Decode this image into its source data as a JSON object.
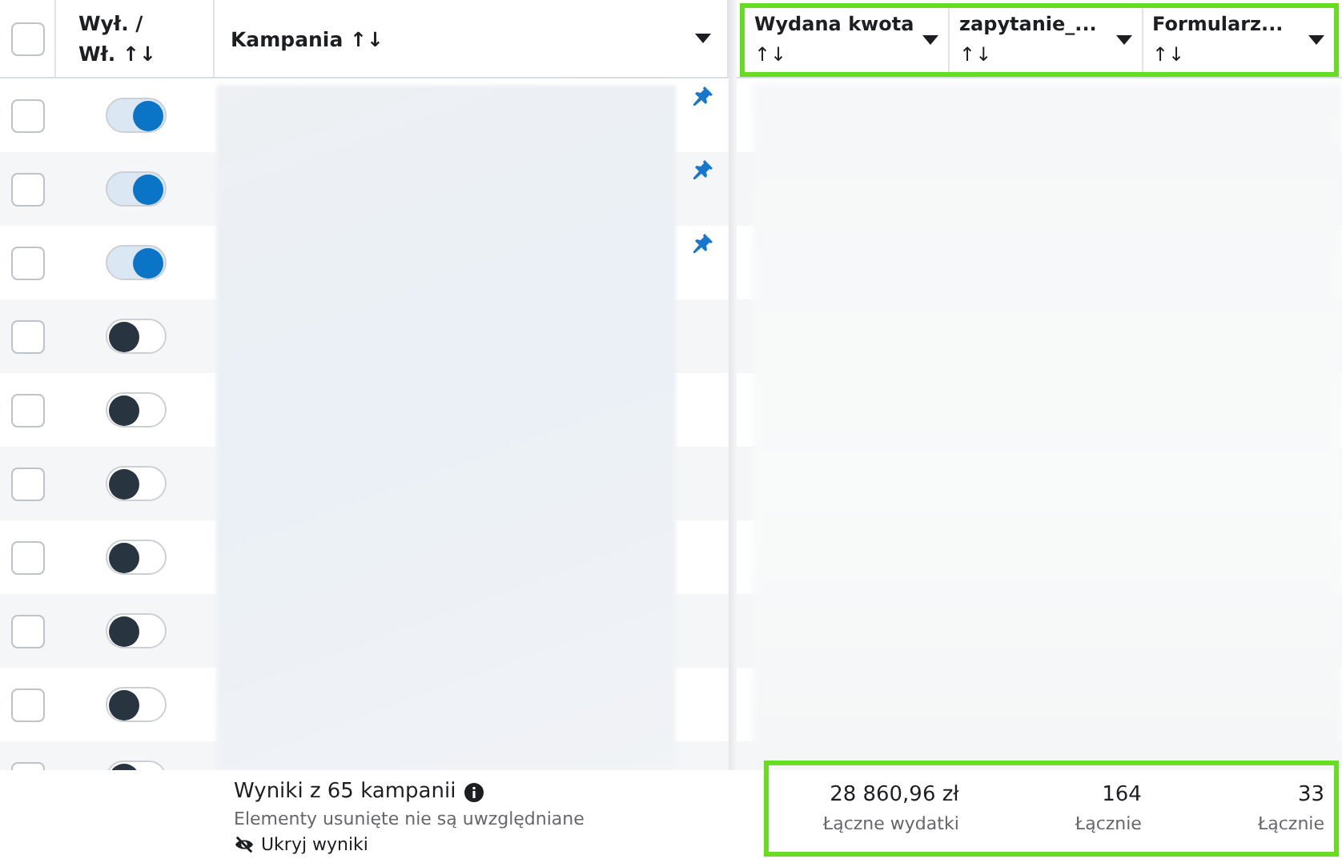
{
  "header": {
    "select_all_checked": false,
    "toggle_column": {
      "line1": "Wył. /",
      "line2": "Wł. ↑↓"
    },
    "campaign_column": {
      "label": "Kampania ↑↓"
    },
    "metric_columns_highlighted": true,
    "metric_columns": [
      {
        "label": "Wydana kwota",
        "sort": "↑↓"
      },
      {
        "label": "zapytanie_...",
        "sort": "↑↓"
      },
      {
        "label": "Formularz...",
        "sort": "↑↓"
      }
    ]
  },
  "rows": [
    {
      "checked": false,
      "on": true,
      "pinned": true
    },
    {
      "checked": false,
      "on": true,
      "pinned": true
    },
    {
      "checked": false,
      "on": true,
      "pinned": true
    },
    {
      "checked": false,
      "on": false,
      "pinned": false
    },
    {
      "checked": false,
      "on": false,
      "pinned": false
    },
    {
      "checked": false,
      "on": false,
      "pinned": false
    },
    {
      "checked": false,
      "on": false,
      "pinned": false
    },
    {
      "checked": false,
      "on": false,
      "pinned": false
    },
    {
      "checked": false,
      "on": false,
      "pinned": false
    },
    {
      "checked": false,
      "on": false,
      "pinned": false
    }
  ],
  "footer": {
    "title": "Wyniki z 65 kampanii",
    "note": "Elementy usunięte nie są uwzględniane",
    "hide_link": "Ukryj wyniki",
    "totals_highlighted": true,
    "totals": [
      {
        "value": "28 860,96 zł",
        "label": "Łączne wydatki"
      },
      {
        "value": "164",
        "label": "Łącznie"
      },
      {
        "value": "33",
        "label": "Łącznie"
      }
    ]
  }
}
